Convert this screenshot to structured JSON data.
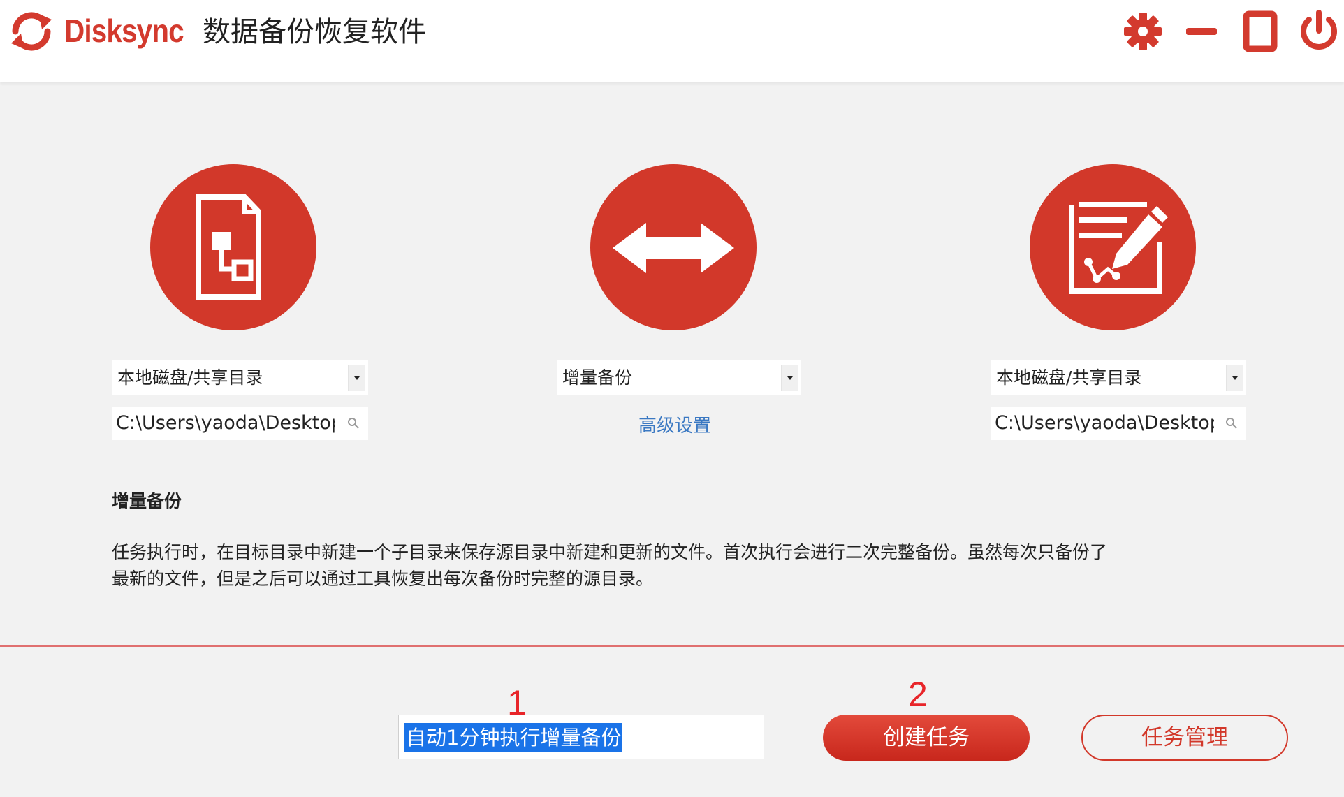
{
  "app": {
    "brand": "Disksync",
    "title": "数据备份恢复软件"
  },
  "window_controls": {
    "settings_icon": "gear-icon",
    "minimize_icon": "minimize-icon",
    "maximize_icon": "maximize-icon",
    "close_icon": "power-icon"
  },
  "source": {
    "icon": "file-structure-icon",
    "type_selected": "本地磁盘/共享目录",
    "path": "C:\\Users\\yaoda\\Desktop"
  },
  "mode": {
    "icon": "double-arrow-icon",
    "selected": "增量备份",
    "advanced_link": "高级设置"
  },
  "target": {
    "icon": "edit-document-icon",
    "type_selected": "本地磁盘/共享目录",
    "path": "C:\\Users\\yaoda\\Desktop"
  },
  "description": {
    "title": "增量备份",
    "line1": "任务执行时，在目标目录中新建一个子目录来保存源目录中新建和更新的文件。首次执行会进行二次完整备份。虽然每次只备份了",
    "line2": "最新的文件，但是之后可以通过工具恢复出每次备份时完整的源目录。"
  },
  "footer": {
    "marker1": "1",
    "marker2": "2",
    "task_name": "自动1分钟执行增量备份",
    "create_label": "创建任务",
    "manage_label": "任务管理"
  },
  "colors": {
    "accent": "#d2382a",
    "link": "#3a78c2",
    "selection": "#1a73e8",
    "marker": "#e8252a"
  }
}
